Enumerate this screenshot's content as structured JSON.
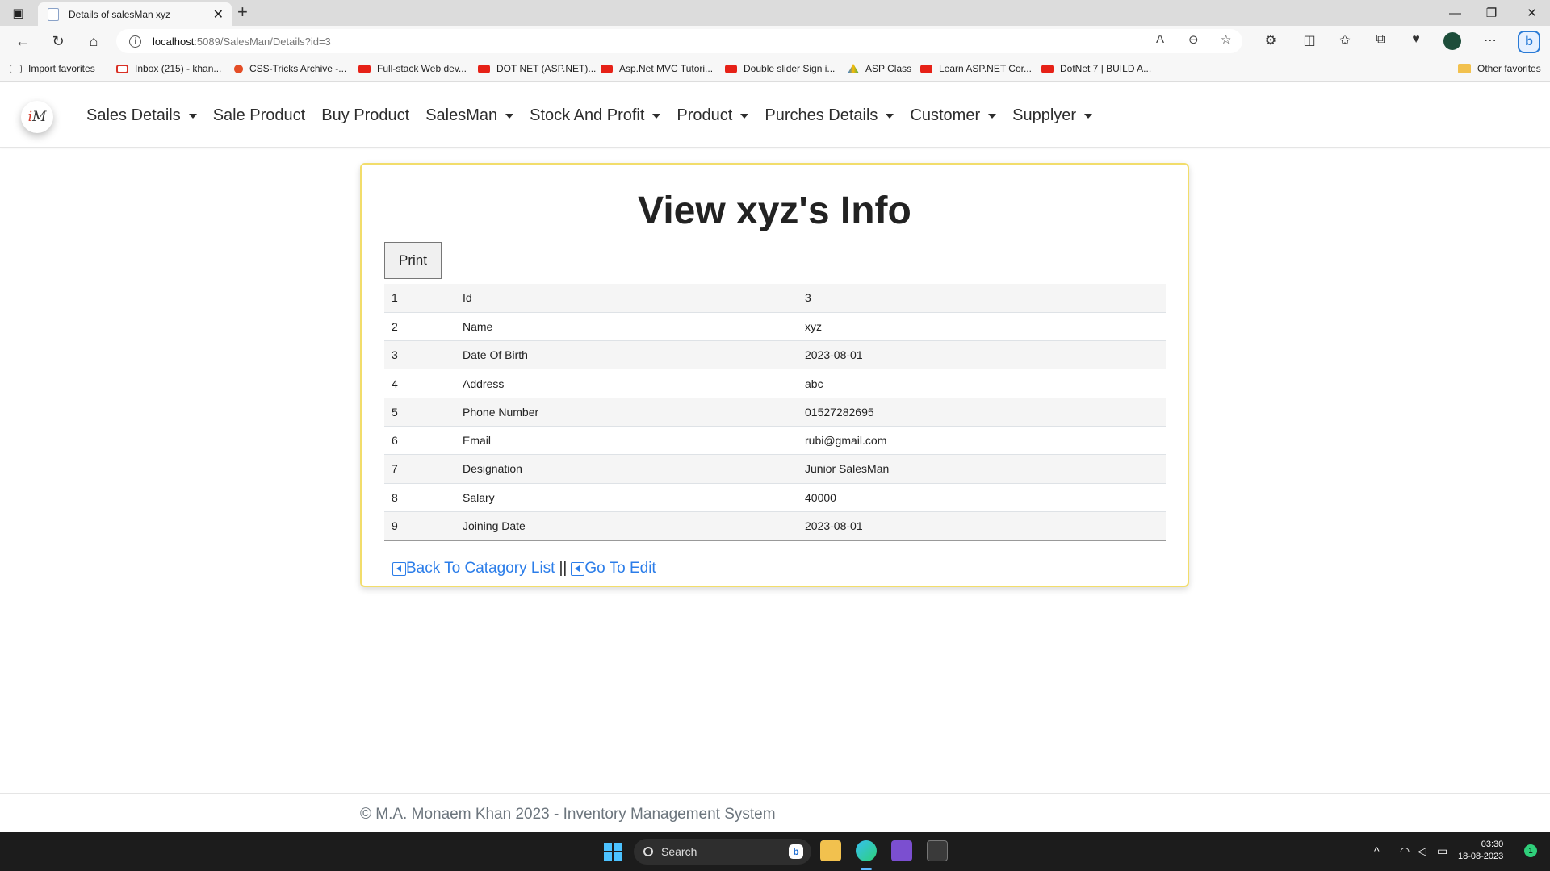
{
  "browser": {
    "tab_title": "Details of salesMan xyz",
    "url_host": "localhost",
    "url_path": ":5089/SalesMan/Details?id=3",
    "favorites": [
      {
        "label": "Import favorites",
        "icon": "import-icon"
      },
      {
        "label": "Inbox (215) - khan...",
        "icon": "gmail-icon"
      },
      {
        "label": "CSS-Tricks Archive -...",
        "icon": "css-tricks-icon"
      },
      {
        "label": "Full-stack Web dev...",
        "icon": "youtube-icon"
      },
      {
        "label": "DOT NET (ASP.NET)...",
        "icon": "youtube-icon"
      },
      {
        "label": "Asp.Net MVC Tutori...",
        "icon": "youtube-icon"
      },
      {
        "label": "Double slider Sign i...",
        "icon": "youtube-icon"
      },
      {
        "label": "ASP Class",
        "icon": "google-drive-icon"
      },
      {
        "label": "Learn ASP.NET Cor...",
        "icon": "youtube-icon"
      },
      {
        "label": "DotNet 7 | BUILD A...",
        "icon": "youtube-icon"
      }
    ],
    "other_favorites": "Other favorites"
  },
  "navbar": {
    "logo_text_1": "M",
    "menu": [
      {
        "label": "Sales Details",
        "dropdown": true
      },
      {
        "label": "Sale Product",
        "dropdown": false
      },
      {
        "label": "Buy Product",
        "dropdown": false
      },
      {
        "label": "SalesMan",
        "dropdown": true
      },
      {
        "label": "Stock And Profit",
        "dropdown": true
      },
      {
        "label": "Product",
        "dropdown": true
      },
      {
        "label": "Purches Details",
        "dropdown": true
      },
      {
        "label": "Customer",
        "dropdown": true
      },
      {
        "label": "Supplyer",
        "dropdown": true
      }
    ]
  },
  "main": {
    "title": "View xyz's Info",
    "print_label": "Print",
    "rows": [
      {
        "n": "1",
        "field": "Id",
        "value": "3"
      },
      {
        "n": "2",
        "field": "Name",
        "value": "xyz"
      },
      {
        "n": "3",
        "field": "Date Of Birth",
        "value": "2023-08-01"
      },
      {
        "n": "4",
        "field": "Address",
        "value": "abc"
      },
      {
        "n": "5",
        "field": "Phone Number",
        "value": "01527282695"
      },
      {
        "n": "6",
        "field": "Email",
        "value": "rubi@gmail.com"
      },
      {
        "n": "7",
        "field": "Designation",
        "value": "Junior SalesMan"
      },
      {
        "n": "8",
        "field": "Salary",
        "value": "40000"
      },
      {
        "n": "9",
        "field": "Joining Date",
        "value": "2023-08-01"
      }
    ],
    "back_link": "Back To Catagory List",
    "separator": "||",
    "edit_link": "Go To Edit"
  },
  "footer": {
    "text": "© M.A. Monaem Khan 2023 - Inventory Management System"
  },
  "taskbar": {
    "search_label": "Search",
    "time": "03:30",
    "date": "18-08-2023",
    "notifications": "1"
  },
  "colors": {
    "accent_link": "#2b7de9",
    "card_border": "#f2dd6b",
    "taskbar_bg": "#1c1c1c"
  }
}
